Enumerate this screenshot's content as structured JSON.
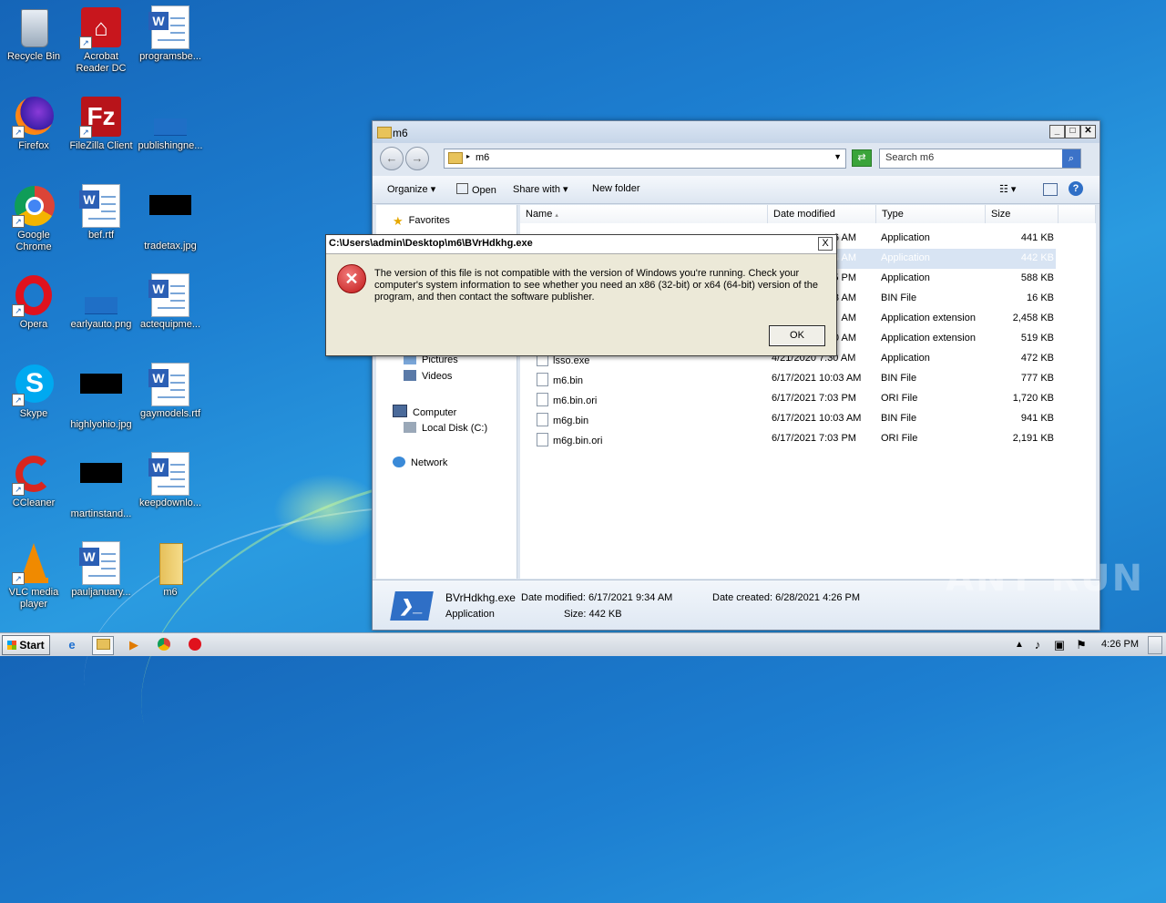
{
  "desktop": {
    "icons": [
      {
        "label": "Recycle Bin"
      },
      {
        "label": "Acrobat Reader DC"
      },
      {
        "label": "programsbe..."
      },
      {
        "label": "Firefox"
      },
      {
        "label": "FileZilla Client"
      },
      {
        "label": "publishingne..."
      },
      {
        "label": "Google Chrome"
      },
      {
        "label": "bef.rtf"
      },
      {
        "label": "tradetax.jpg"
      },
      {
        "label": "Opera"
      },
      {
        "label": "earlyauto.png"
      },
      {
        "label": "actequipme..."
      },
      {
        "label": "Skype"
      },
      {
        "label": "highlyohio.jpg"
      },
      {
        "label": "gaymodels.rtf"
      },
      {
        "label": "CCleaner"
      },
      {
        "label": "martinstand..."
      },
      {
        "label": "keepdownlo..."
      },
      {
        "label": "VLC media player"
      },
      {
        "label": "pauljanuary..."
      },
      {
        "label": "m6"
      }
    ]
  },
  "explorer": {
    "title": "m6",
    "address": "m6",
    "search_placeholder": "Search m6",
    "toolbar": {
      "organize": "Organize",
      "open": "Open",
      "share_with": "Share with",
      "new_folder": "New folder"
    },
    "nav": {
      "favorites": "Favorites",
      "pictures": "Pictures",
      "videos": "Videos",
      "computer": "Computer",
      "local_disk": "Local Disk (C:)",
      "network": "Network"
    },
    "columns": {
      "name": "Name",
      "date": "Date modified",
      "type": "Type",
      "size": "Size"
    },
    "rows": [
      {
        "name": "",
        "date": "6 AM",
        "type": "Application",
        "size": "441 KB"
      },
      {
        "name": "",
        "date": "4 AM",
        "type": "Application",
        "size": "442 KB"
      },
      {
        "name": "",
        "date": "15 PM",
        "type": "Application",
        "size": "588 KB"
      },
      {
        "name": "",
        "date": "03 AM",
        "type": "BIN File",
        "size": "16 KB"
      },
      {
        "name": "",
        "date": "AM",
        "type": "Application extension",
        "size": "2,458 KB"
      },
      {
        "name": "",
        "date": "0 AM",
        "type": "Application extension",
        "size": "519 KB"
      },
      {
        "name": "lsso.exe",
        "date": "4/21/2020 7:30 AM",
        "type": "Application",
        "size": "472 KB"
      },
      {
        "name": "m6.bin",
        "date": "6/17/2021 10:03 AM",
        "type": "BIN File",
        "size": "777 KB"
      },
      {
        "name": "m6.bin.ori",
        "date": "6/17/2021 7:03 PM",
        "type": "ORI File",
        "size": "1,720 KB"
      },
      {
        "name": "m6g.bin",
        "date": "6/17/2021 10:03 AM",
        "type": "BIN File",
        "size": "941 KB"
      },
      {
        "name": "m6g.bin.ori",
        "date": "6/17/2021 7:03 PM",
        "type": "ORI File",
        "size": "2,191 KB"
      }
    ],
    "details": {
      "filename": "BVrHdkhg.exe",
      "filetype": "Application",
      "date_modified": "Date modified: 6/17/2021 9:34 AM",
      "size": "Size: 442 KB",
      "date_created": "Date created: 6/28/2021 4:26 PM"
    }
  },
  "dialog": {
    "title": "C:\\Users\\admin\\Desktop\\m6\\BVrHdkhg.exe",
    "message": "The version of this file is not compatible with the version of Windows you're running. Check your computer's system information to see whether you need an x86 (32-bit) or x64 (64-bit) version of the program, and then contact the software publisher.",
    "ok": "OK",
    "close": "X"
  },
  "taskbar": {
    "start": "Start",
    "clock": "4:26 PM"
  },
  "watermark": "ANY RUN",
  "colors": {
    "error_red": "#c01818",
    "selected_row": "#d8e4f3",
    "desktop_blue": "#1d7fd1"
  }
}
